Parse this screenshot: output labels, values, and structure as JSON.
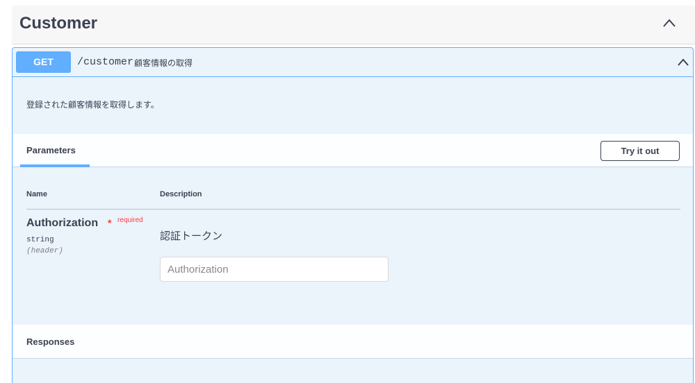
{
  "tag": {
    "title": "Customer",
    "collapse_icon": "chevron-up-icon"
  },
  "operation": {
    "method": "GET",
    "path": "/customer",
    "summary": "顧客情報の取得",
    "description": "登録された顧客情報を取得します。",
    "method_color": "#61affe",
    "collapse_icon": "chevron-up-icon"
  },
  "parameters": {
    "tab_label": "Parameters",
    "try_button": "Try it out",
    "columns": {
      "name": "Name",
      "description": "Description"
    },
    "items": [
      {
        "name": "Authorization",
        "required_mark": "*",
        "required_label": "required",
        "type": "string",
        "in": "(header)",
        "description": "認証トークン",
        "placeholder": "Authorization"
      }
    ]
  },
  "responses": {
    "title": "Responses"
  }
}
